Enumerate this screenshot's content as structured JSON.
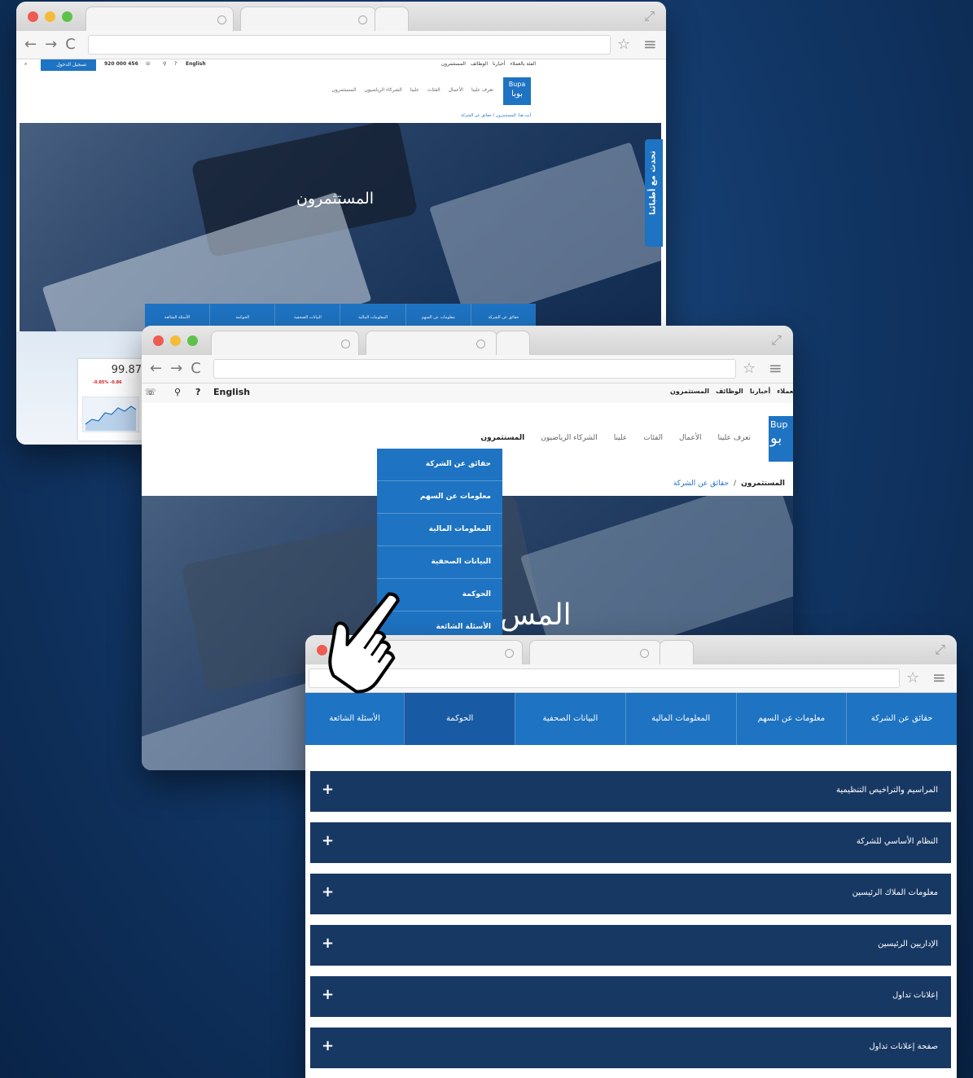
{
  "win1": {
    "topbar": {
      "login_label": "تسجيل الدخول",
      "phone": "920 000 456",
      "help": "?",
      "lang": "English",
      "links": [
        "المستثمرون",
        "الوظائف",
        "أخبارنا",
        "الفئة بالعملاء"
      ]
    },
    "logo": {
      "latin": "Bupa",
      "arabic": "بوبا"
    },
    "nav_items": [
      "تعرف علينا",
      "الأعمال",
      "الفئات",
      "علينا",
      "الشركاء الرياضيون",
      "المستثمرون"
    ],
    "breadcrumb": "أنت هنا: المستثمرون / حقائق عن الشركة",
    "hero_title": "المستثمرون",
    "chat_tab": "تحدث مع أطبائنا",
    "subnav": [
      "حقائق عن الشركة",
      "معلومات عن السهم",
      "المعلومات المالية",
      "البيانات الصحفية",
      "الحوكمة",
      "الأسئلة الشائعة"
    ],
    "stock": {
      "price": "99.87",
      "change": "-0.85% -0.86"
    }
  },
  "win2": {
    "topbar": {
      "lang": "English",
      "help": "?",
      "links": [
        "المستثمرون",
        "الوظائف",
        "أخبارنا",
        "العملاء"
      ]
    },
    "logo": {
      "latin": "Bup",
      "arabic": "بو"
    },
    "nav_items": [
      "تعرف علينا",
      "الأعمال",
      "الفئات",
      "علينا",
      "الشركاء الرياضيون",
      "المستثمرون"
    ],
    "dropdown": [
      "حقائق عن الشركة",
      "معلومات عن السهم",
      "المعلومات المالية",
      "البيانات الصحفية",
      "الحوكمة",
      "الأسئلة الشائعة"
    ],
    "breadcrumb": {
      "root": "المستثمرون",
      "sep": "/",
      "current": "حقائق عن الشركة"
    },
    "hero_title": "المس"
  },
  "win3": {
    "tabs": [
      {
        "label": "حقائق عن الشركة",
        "active": false
      },
      {
        "label": "معلومات عن السهم",
        "active": false
      },
      {
        "label": "المعلومات المالية",
        "active": false
      },
      {
        "label": "البيانات الصحفية",
        "active": false
      },
      {
        "label": "الحوكمة",
        "active": true
      },
      {
        "label": "الأسئلة الشائعة",
        "active": false
      }
    ],
    "accordion": [
      {
        "label": "المراسيم والتراخيص التنظيمية",
        "icon": "+"
      },
      {
        "label": "النظام الأساسي للشركة",
        "icon": "+"
      },
      {
        "label": "معلومات الملاك الرئيسين",
        "icon": "+"
      },
      {
        "label": "الإداريين الرئيسين",
        "icon": "+"
      },
      {
        "label": "إعلانات تداول",
        "icon": "+"
      },
      {
        "label": "صفحة إعلانات تداول",
        "icon": "+"
      }
    ]
  },
  "colors": {
    "accent": "#1e73c2",
    "navy": "#183864",
    "active_tab": "#185aa3"
  }
}
